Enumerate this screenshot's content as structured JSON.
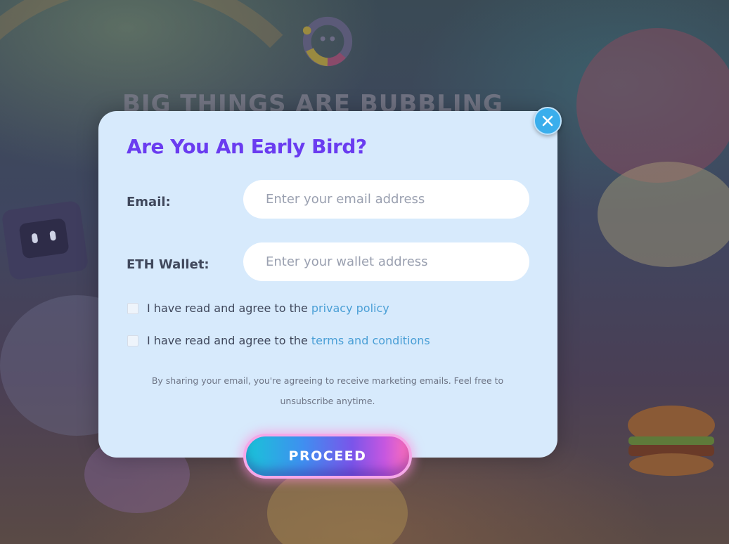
{
  "background": {
    "headline": "BIG THINGS ARE BUBBLING",
    "logo_icon": "smiley-ring-logo"
  },
  "modal": {
    "title": "Are You An Early Bird?",
    "close_icon": "close-icon",
    "email": {
      "label": "Email:",
      "placeholder": "Enter your email address",
      "value": ""
    },
    "wallet": {
      "label": "ETH Wallet:",
      "placeholder": "Enter your wallet address",
      "value": ""
    },
    "agreements": [
      {
        "text": "I have read and agree to the",
        "link": "privacy policy",
        "checked": false
      },
      {
        "text": "I have read and agree to the",
        "link": "terms and conditions",
        "checked": false
      }
    ],
    "note": "By sharing your email, you're agreeing to receive marketing emails. Feel free to unsubscribe anytime.",
    "proceed_label": "PROCEED"
  },
  "colors": {
    "title": "#6a3cf0",
    "link": "#4a9fd6",
    "modal_bg": "#d7eafc",
    "close_button": "#3aaeec"
  }
}
